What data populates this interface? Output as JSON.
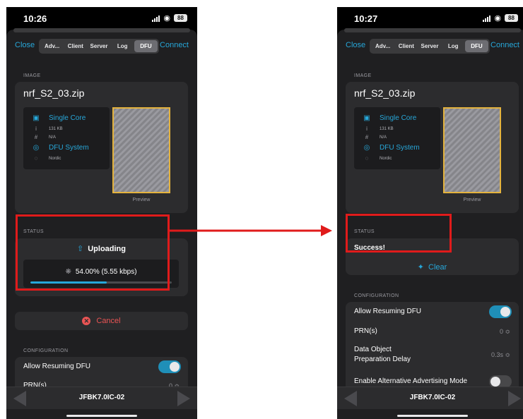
{
  "left": {
    "time": "10:26",
    "battery": "88",
    "nav": {
      "close": "Close",
      "connect": "Connect",
      "segments": [
        "Adv...",
        "Client",
        "Server",
        "Log",
        "DFU"
      ],
      "active_segment": "DFU"
    },
    "image": {
      "section": "IMAGE",
      "filename": "nrf_S2_03.zip",
      "core": "Single Core",
      "size": "131 KB",
      "hash": "N/A",
      "system": "DFU System",
      "vendor": "Nordic",
      "preview": "Preview"
    },
    "status": {
      "section": "STATUS",
      "state": "Uploading",
      "progress_text": "54.00% (5.55 kbps)",
      "progress_percent": 54
    },
    "cancel": "Cancel",
    "config": {
      "section": "CONFIGURATION",
      "allow_resuming": "Allow Resuming DFU",
      "allow_resuming_on": true,
      "prn": "PRN(s)",
      "prn_value": "0 ≎"
    },
    "device": "JFBK7.0IC-02"
  },
  "right": {
    "time": "10:27",
    "battery": "88",
    "nav": {
      "close": "Close",
      "connect": "Connect",
      "segments": [
        "Adv...",
        "Client",
        "Server",
        "Log",
        "DFU"
      ],
      "active_segment": "DFU"
    },
    "image": {
      "section": "IMAGE",
      "filename": "nrf_S2_03.zip",
      "core": "Single Core",
      "size": "131 KB",
      "hash": "N/A",
      "system": "DFU System",
      "vendor": "Nordic",
      "preview": "Preview"
    },
    "status": {
      "section": "STATUS",
      "state": "Success!",
      "clear": "Clear"
    },
    "config": {
      "section": "CONFIGURATION",
      "allow_resuming": "Allow Resuming DFU",
      "allow_resuming_on": true,
      "prn": "PRN(s)",
      "prn_value": "0 ≎",
      "data_object_1": "Data Object",
      "data_object_2": "Preparation Delay",
      "data_object_value": "0.3s ≎",
      "alt_adv": "Enable Alternative Advertising Mode",
      "alt_adv_on": false
    },
    "device": "JFBK7.0IC-02"
  },
  "colors": {
    "accent": "#27a7d9",
    "highlight": "#e01b1b",
    "cancel": "#ea5454",
    "preview_border": "#e4b33e"
  }
}
